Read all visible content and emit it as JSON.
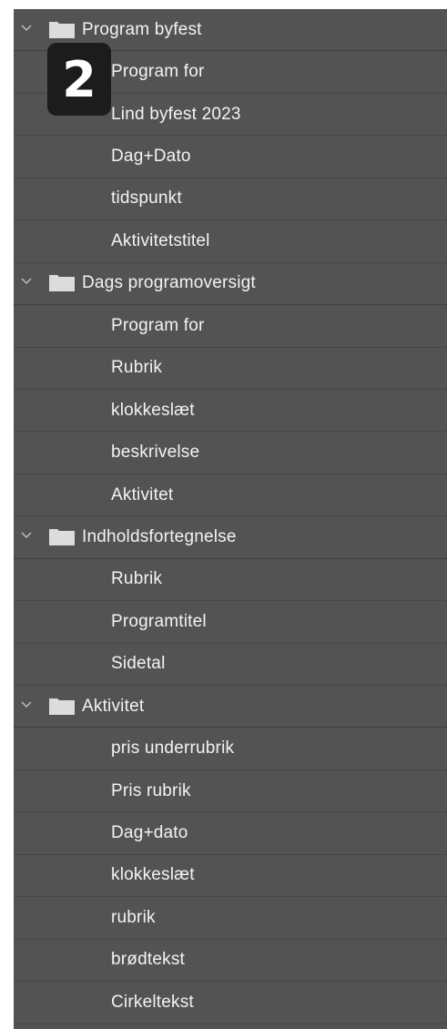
{
  "badge": {
    "number": "2"
  },
  "groups": [
    {
      "label": "Program byfest",
      "items": [
        "Program for",
        "Lind byfest 2023",
        "Dag+Dato",
        "tidspunkt",
        "Aktivitetstitel"
      ]
    },
    {
      "label": "Dags programoversigt",
      "items": [
        "Program for",
        "Rubrik",
        "klokkeslæt",
        "beskrivelse",
        "Aktivitet"
      ]
    },
    {
      "label": "Indholdsfortegnelse",
      "items": [
        "Rubrik",
        "Programtitel",
        "Sidetal"
      ]
    },
    {
      "label": "Aktivitet",
      "items": [
        "pris underrubrik",
        "Pris rubrik",
        "Dag+dato",
        "klokkeslæt",
        "rubrik",
        "brødtekst",
        "Cirkeltekst"
      ]
    }
  ],
  "icons": {
    "expand": "chevron-down-icon",
    "folder": "folder-icon"
  },
  "colors": {
    "panel_bg": "#535353",
    "row_divider": "#474747",
    "text": "#f3f3f3",
    "badge_bg": "#1c1c1c"
  }
}
